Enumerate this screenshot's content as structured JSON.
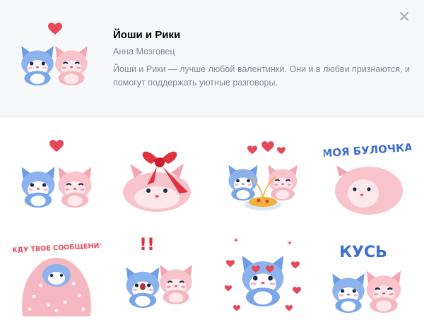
{
  "pack": {
    "title": "Йоши и Рики",
    "author": "Анна Мозговец",
    "description": "Йоши и Рики — лучше любой валентинки. Они и в любви признаются, и помогут поддержать уютные разговоры."
  },
  "icons": {
    "close": "close-icon"
  },
  "colors": {
    "blue_cat": "#7aa6ea",
    "pink_cat": "#f6b8c0",
    "heart": "#e64a5a",
    "caption": "#3d6fd1"
  },
  "stickers": [
    {
      "name": "sticker-cats-together",
      "caption": ""
    },
    {
      "name": "sticker-cat-with-bow",
      "caption": ""
    },
    {
      "name": "sticker-cats-spaghetti",
      "caption": ""
    },
    {
      "name": "sticker-my-bun",
      "caption": "МОЯ БУЛОЧКА"
    },
    {
      "name": "sticker-waiting-message",
      "caption": "ЖДУ ТВОЕ СООБЩЕНИЕ"
    },
    {
      "name": "sticker-surprised-cats",
      "caption": "!!"
    },
    {
      "name": "sticker-love-eyes",
      "caption": ""
    },
    {
      "name": "sticker-bite",
      "caption": "КУСЬ"
    }
  ]
}
